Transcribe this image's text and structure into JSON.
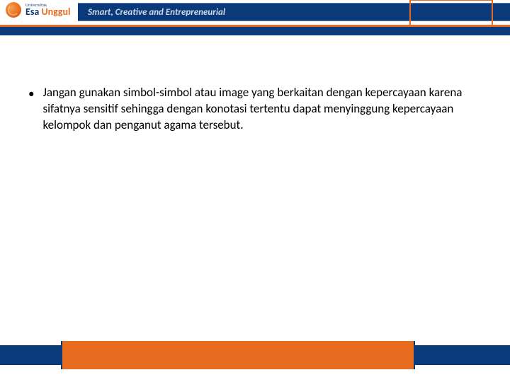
{
  "header": {
    "logo_super": "Universitas",
    "logo_name_main": "Esa",
    "logo_name_accent": "Unggul",
    "tagline": "Smart, Creative and Entrepreneurial"
  },
  "content": {
    "bullets": [
      "Jangan gunakan simbol-simbol atau image yang berkaitan dengan kepercayaan karena sifatnya sensitif sehingga dengan konotasi tertentu dapat menyinggung kepercayaan kelompok dan penganut agama tersebut."
    ]
  }
}
